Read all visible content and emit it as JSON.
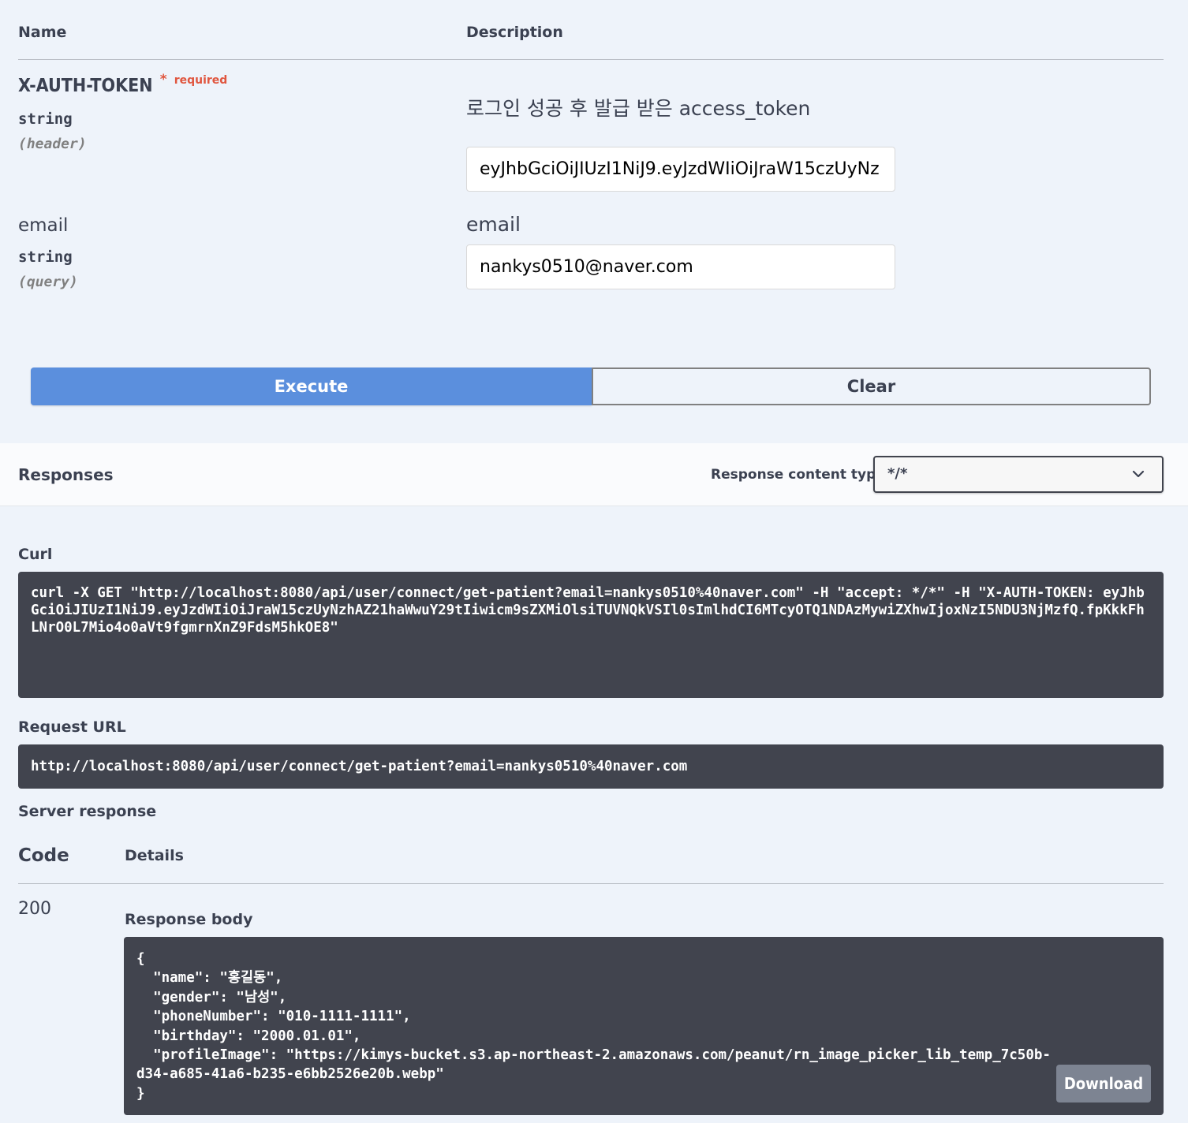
{
  "params_header": {
    "name_label": "Name",
    "description_label": "Description"
  },
  "params": [
    {
      "name": "X-AUTH-TOKEN",
      "required_star": "*",
      "required_label": "required",
      "type": "string",
      "location": "(header)",
      "description": "로그인 성공 후 발급 받은 access_token",
      "value": "eyJhbGciOiJIUzI1NiJ9.eyJzdWIiOiJraW15czUyNz"
    },
    {
      "name": "email",
      "type": "string",
      "location": "(query)",
      "description": "email",
      "value": "nankys0510@naver.com"
    }
  ],
  "actions": {
    "execute_label": "Execute",
    "clear_label": "Clear"
  },
  "responses": {
    "title": "Responses",
    "content_type_label": "Response content type",
    "content_type_value": "*/*"
  },
  "curl": {
    "label": "Curl",
    "command": "curl -X GET \"http://localhost:8080/api/user/connect/get-patient?email=nankys0510%40naver.com\" -H \"accept: */*\" -H \"X-AUTH-TOKEN: eyJhbGciOiJIUzI1NiJ9.eyJzdWIiOiJraW15czUyNzhAZ21haWwuY29tIiwicm9sZXMiOlsiTUVNQkVSIl0sImlhdCI6MTcyOTQ1NDAzMywiZXhwIjoxNzI5NDU3NjMzfQ.fpKkkFhLNrO0L7Mio4o0aVt9fgmrnXnZ9FdsM5hkOE8\""
  },
  "request_url": {
    "label": "Request URL",
    "value": "http://localhost:8080/api/user/connect/get-patient?email=nankys0510%40naver.com"
  },
  "server_response": {
    "label": "Server response",
    "code_header": "Code",
    "details_header": "Details",
    "code": "200",
    "body_label": "Response body",
    "body_lines": [
      "{",
      "  \"name\": \"홍길동\",",
      "  \"gender\": \"남성\",",
      "  \"phoneNumber\": \"010-1111-1111\",",
      "  \"birthday\": \"2000.01.01\",",
      "  \"profileImage\": \"https://kimys-bucket.s3.ap-northeast-2.amazonaws.com/peanut/rn_image_picker_lib_temp_7c50b-",
      "d34-a685-41a6-b235-e6bb2526e20b.webp\"",
      "}"
    ],
    "download_label": "Download"
  }
}
